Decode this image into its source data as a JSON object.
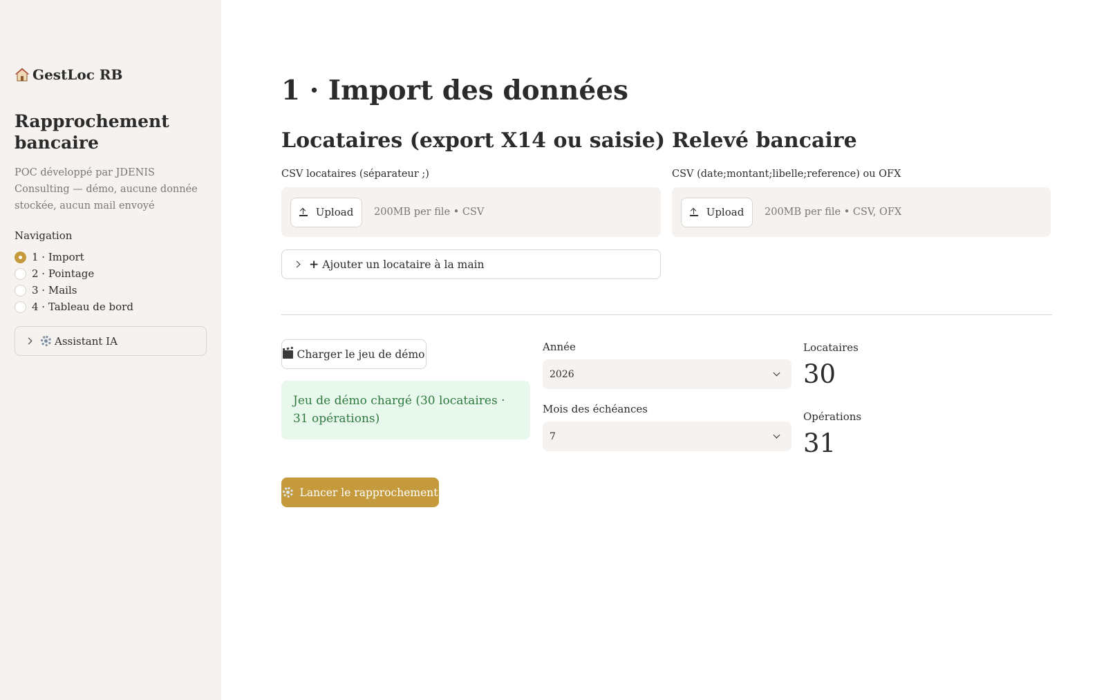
{
  "colors": {
    "accent": "#c49a3c",
    "sidebar_bg": "#f5f2ef",
    "success_bg": "#e9f8ec",
    "success_text": "#2d7a3f"
  },
  "sidebar": {
    "brand": "GestLoc RB",
    "brand_icon": "house-icon",
    "title": "Rapprochement bancaire",
    "caption": "POC développé par JDENIS Consulting — démo, aucune donnée stockée, aucun mail envoyé",
    "nav_label": "Navigation",
    "nav_items": [
      {
        "label": "1 · Import",
        "selected": true
      },
      {
        "label": "2 · Pointage",
        "selected": false
      },
      {
        "label": "3 · Mails",
        "selected": false
      },
      {
        "label": "4 · Tableau de bord",
        "selected": false
      }
    ],
    "assistant_label": "Assistant IA",
    "assistant_icon": "gear-icon"
  },
  "main": {
    "title": "1 · Import des données",
    "tenants": {
      "title": "Locataires (export X14 ou saisie)",
      "field_label": "CSV locataires (séparateur ;)",
      "upload_label": "Upload",
      "hint": "200MB per file • CSV",
      "expander_label": "Ajouter un locataire à la main"
    },
    "bank": {
      "title": "Relevé bancaire",
      "field_label": "CSV (date;montant;libelle;reference) ou OFX",
      "upload_label": "Upload",
      "hint": "200MB per file • CSV, OFX"
    },
    "demo_button": "Charger le jeu de démo",
    "demo_icon": "clapperboard-icon",
    "alert_text": "Jeu de démo chargé (30 locataires · 31 opérations)",
    "year": {
      "label": "Année",
      "value": "2026"
    },
    "month": {
      "label": "Mois des échéances",
      "value": "7"
    },
    "metrics": [
      {
        "label": "Locataires",
        "value": "30"
      },
      {
        "label": "Opérations",
        "value": "31"
      }
    ],
    "run_button": "Lancer le rapprochement",
    "run_icon": "gear-icon"
  }
}
